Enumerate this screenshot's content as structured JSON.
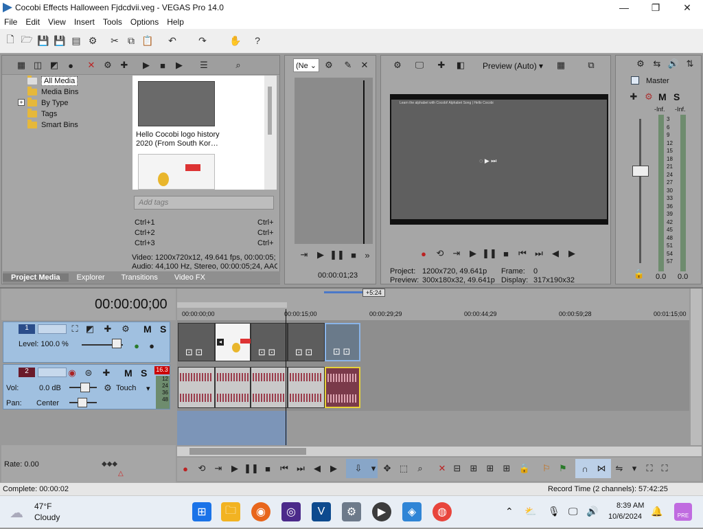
{
  "window": {
    "title": "Cocobi Effects Halloween Fjdcdvii.veg - VEGAS Pro 14.0"
  },
  "menu": [
    "File",
    "Edit",
    "View",
    "Insert",
    "Tools",
    "Options",
    "Help"
  ],
  "explorer": {
    "tree": [
      {
        "label": "All Media",
        "selected": true
      },
      {
        "label": "Media Bins"
      },
      {
        "label": "By Type",
        "expander": "+"
      },
      {
        "label": "Tags"
      },
      {
        "label": "Smart Bins"
      }
    ],
    "media_item_caption": "Hello Cocobi logo history 2020 (From South Kor…",
    "tags_placeholder": "Add tags",
    "shortcuts": [
      {
        "left": "Ctrl+1",
        "right": "Ctrl+"
      },
      {
        "left": "Ctrl+2",
        "right": "Ctrl+"
      },
      {
        "left": "Ctrl+3",
        "right": "Ctrl+"
      }
    ],
    "info_video": "Video: 1200x720x12, 49.641 fps, 00:00:05;",
    "info_audio": "Audio: 44,100 Hz, Stereo, 00:00:05;24, AAC",
    "tabs": [
      "Project Media",
      "Explorer",
      "Transitions",
      "Video FX"
    ]
  },
  "trimmer": {
    "dropdown": "(Ne",
    "timecode": "00:00:01;23"
  },
  "preview": {
    "mode": "Preview (Auto)",
    "project_label": "Project:",
    "project_value": "1200x720, 49.641p",
    "preview_label": "Preview:",
    "preview_value": "300x180x32, 49.641p",
    "frame_label": "Frame:",
    "frame_value": "0",
    "display_label": "Display:",
    "display_value": "317x190x32",
    "screen_text": "Learn the alphabet with Cocobi! Alphabet Song | Hello Cocobi"
  },
  "master": {
    "label": "Master",
    "m": "M",
    "s": "S",
    "inf_left": "-Inf.",
    "inf_right": "-Inf.",
    "scale": [
      "3",
      "6",
      "9",
      "12",
      "15",
      "18",
      "21",
      "24",
      "27",
      "30",
      "33",
      "36",
      "39",
      "42",
      "45",
      "48",
      "51",
      "54",
      "57"
    ],
    "bottom_left": "0.0",
    "bottom_right": "0.0"
  },
  "timeline": {
    "cursor_time": "00:00:00;00",
    "loop_badge": "+5:24",
    "ruler": [
      "00:00:00;00",
      "00:00:15;00",
      "00:00:29;29",
      "00:00:44;29",
      "00:00:59;28",
      "00:01:15;00"
    ],
    "video_track": {
      "number": "1",
      "level": "Level: 100.0 %",
      "m": "M",
      "s": "S"
    },
    "audio_track": {
      "number": "2",
      "vol_label": "Vol:",
      "vol_value": "0.0 dB",
      "pan_label": "Pan:",
      "pan_value": "Center",
      "mode": "Touch",
      "m": "M",
      "s": "S",
      "meter_top": "16.3",
      "meter": [
        "12",
        "24",
        "36",
        "48"
      ]
    },
    "rate": "Rate: 0.00"
  },
  "status": {
    "left": "Complete: 00:00:02",
    "right": "Record Time (2 channels): 57:42:25"
  },
  "taskbar": {
    "temp": "47°F",
    "weather": "Cloudy",
    "time": "8:39 AM",
    "date": "10/6/2024",
    "badge": "PRE"
  }
}
